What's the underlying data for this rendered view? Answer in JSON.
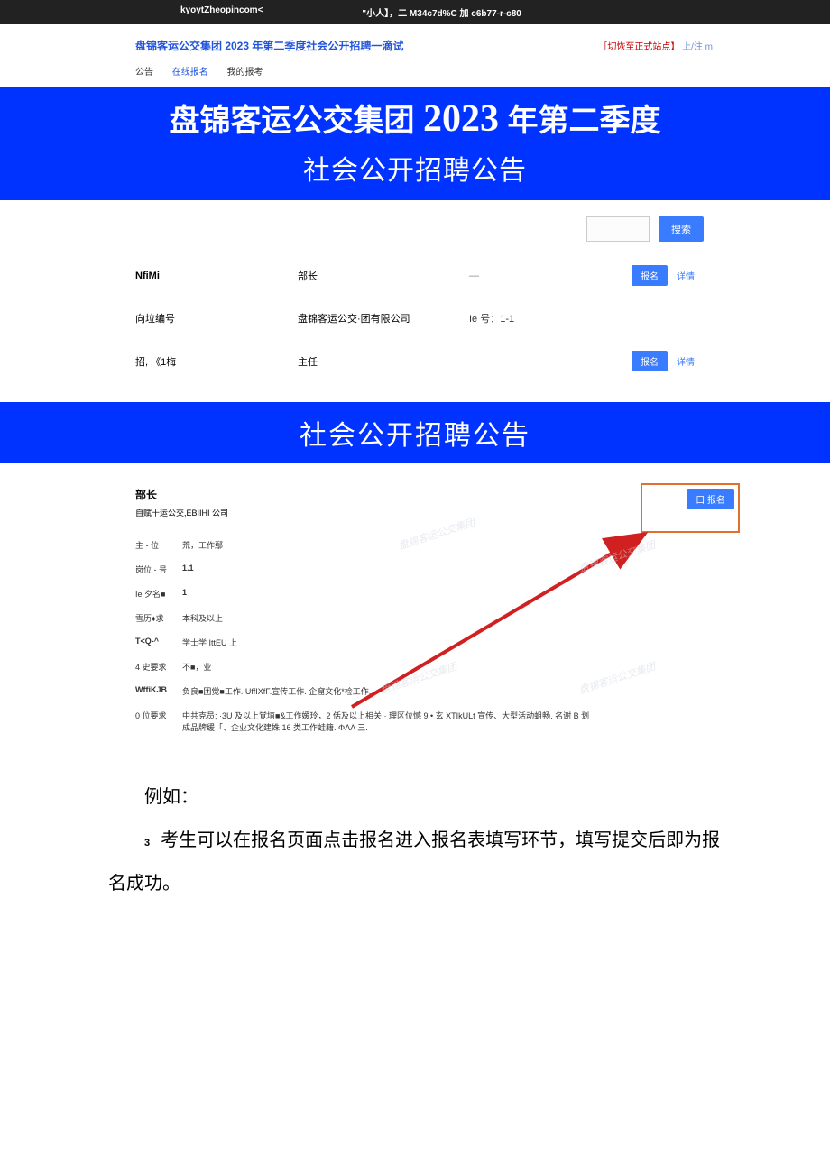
{
  "topbar": {
    "left": "kyoytZheopincom<",
    "center": "\"小人】，二 M34c7d%C 加 c6b77-r-c80"
  },
  "header": {
    "title": "盘锦客运公交集团 2023 年第二季度社会公开招聘一滴试",
    "switch": "［切恢至正式站点】",
    "login": "上/注 m"
  },
  "nav": {
    "item1": "公告",
    "item2": "在线报名",
    "item3": "我的报考"
  },
  "banner": {
    "prefix": "盘锦客运公交集团 ",
    "year": "2023",
    "suffix": " 年第二季度",
    "line2": "社会公开招聘公告"
  },
  "search": {
    "button": "搜索"
  },
  "listing": {
    "row1": {
      "c1": "NfiMi",
      "c2": "部长",
      "c3": "—",
      "btn": "报名",
      "link": "详情"
    },
    "row2": {
      "c1": "向垃编号",
      "c2": "盘锦客运公交·团有限公司",
      "c3": "Ie 号：1-1"
    },
    "row3": {
      "c1": "招, 《1梅",
      "c2": "主任",
      "btn": "报名",
      "link": "详情"
    }
  },
  "banner2": "社会公开招聘公告",
  "detail": {
    "title": "部长",
    "sub": "自赋十运公交,EBIIHI 公司",
    "applyBtn": "口 报名",
    "rows": [
      {
        "label": "主 - 位",
        "val": "荒，工作鄢"
      },
      {
        "label": "岗位 - 号",
        "val": "1.1"
      },
      {
        "label": "Ie 夕名■",
        "val": "1"
      },
      {
        "label": "雪历♦求",
        "val": "本科及以上"
      },
      {
        "label": "T<Q-^",
        "val": "学士学 IttEU 上"
      },
      {
        "label": "4 史要求",
        "val": "不■，业"
      },
      {
        "label": "WffiKJB",
        "val": "负良■团觉■工作. UffIXfF.宣传工作. 企窟文化*检工作."
      },
      {
        "label": "0 位要求",
        "val": "中共克员; ·3U 及以上覚埴■&工作媛玲，2 佸及以上相关 · 理区位憾 9 • 玄 XTIkULt 宣传、大型活动蛆畅. 名谢 B 划成品牌缓「、企业文化建姝 16 类工作蛙籍. ΦΛΛ 三."
      }
    ]
  },
  "bodyText": {
    "example": "例如：",
    "step3num": "3",
    "step3": "考生可以在报名页面点击报名进入报名表填写环节，填写提交后即为报名成功。"
  }
}
